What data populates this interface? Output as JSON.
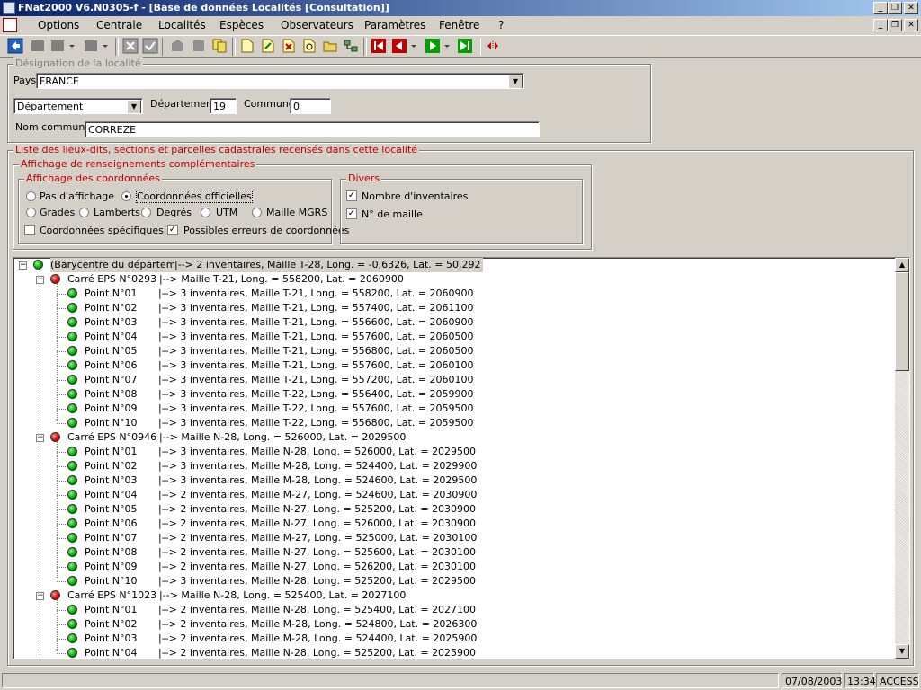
{
  "window": {
    "title": "FNat2000 V6.N0305-f - [Base de données Localités [Consultation]]"
  },
  "menu": [
    {
      "label": "Options"
    },
    {
      "label": "Centrale"
    },
    {
      "label": "Localités"
    },
    {
      "label": "Espèces"
    },
    {
      "label": "Observateurs"
    },
    {
      "label": "Paramètres"
    },
    {
      "label": "Fenêtre"
    },
    {
      "label": "?"
    }
  ],
  "designation": {
    "group_label": "Désignation de la localité",
    "pays_label": "Pays",
    "pays_value": "FRANCE",
    "type_value": "Département",
    "departement_label": "Département",
    "departement_value": "19",
    "commune_label": "Commune",
    "commune_value": "0",
    "nom_commune_label": "Nom commune",
    "nom_commune_value": "CORREZE"
  },
  "liste": {
    "group_label": "Liste des lieux-dits, sections et parcelles cadastrales recensés dans cette localité",
    "affichage_label": "Affichage de renseignements complémentaires",
    "coord_label": "Affichage des coordonnées",
    "opt_pas": "Pas d'affichage",
    "opt_officielles": "Coordonnées officielles",
    "opt_grades": "Grades",
    "opt_lamberts": "Lamberts",
    "opt_degres": "Degrés",
    "opt_utm": "UTM",
    "opt_maille": "Maille MGRS",
    "chk_specifiques": "Coordonnées spécifiques",
    "chk_erreurs": "Possibles erreurs de coordonnées",
    "divers_label": "Divers",
    "chk_nombre": "Nombre d'inventaires",
    "chk_maille": "N° de maille"
  },
  "tree": {
    "root": {
      "label": "(Barycentre du département)",
      "info": "|--> 2 inventaires, Maille T-28, Long. = -0,6326, Lat. = 50,292"
    },
    "groups": [
      {
        "label": "Carré EPS N°0293",
        "info": "|--> Maille T-21, Long. = 558200, Lat. = 2060900",
        "points": [
          {
            "label": "Point N°01",
            "info": "|--> 3 inventaires, Maille T-21, Long. = 558200, Lat. = 2060900"
          },
          {
            "label": "Point N°02",
            "info": "|--> 3 inventaires, Maille T-21, Long. = 557400, Lat. = 2061100"
          },
          {
            "label": "Point N°03",
            "info": "|--> 3 inventaires, Maille T-21, Long. = 556600, Lat. = 2060900"
          },
          {
            "label": "Point N°04",
            "info": "|--> 3 inventaires, Maille T-21, Long. = 557600, Lat. = 2060500"
          },
          {
            "label": "Point N°05",
            "info": "|--> 3 inventaires, Maille T-21, Long. = 556800, Lat. = 2060500"
          },
          {
            "label": "Point N°06",
            "info": "|--> 3 inventaires, Maille T-21, Long. = 557600, Lat. = 2060100"
          },
          {
            "label": "Point N°07",
            "info": "|--> 3 inventaires, Maille T-21, Long. = 557200, Lat. = 2060100"
          },
          {
            "label": "Point N°08",
            "info": "|--> 3 inventaires, Maille T-22, Long. = 556400, Lat. = 2059900"
          },
          {
            "label": "Point N°09",
            "info": "|--> 3 inventaires, Maille T-22, Long. = 557600, Lat. = 2059500"
          },
          {
            "label": "Point N°10",
            "info": "|--> 3 inventaires, Maille T-22, Long. = 556800, Lat. = 2059500"
          }
        ]
      },
      {
        "label": "Carré EPS N°0946",
        "info": "|--> Maille N-28, Long. = 526000, Lat. = 2029500",
        "points": [
          {
            "label": "Point N°01",
            "info": "|--> 3 inventaires, Maille N-28, Long. = 526000, Lat. = 2029500"
          },
          {
            "label": "Point N°02",
            "info": "|--> 3 inventaires, Maille M-28, Long. = 524400, Lat. = 2029900"
          },
          {
            "label": "Point N°03",
            "info": "|--> 3 inventaires, Maille M-28, Long. = 524600, Lat. = 2029500"
          },
          {
            "label": "Point N°04",
            "info": "|--> 2 inventaires, Maille M-27, Long. = 524600, Lat. = 2030900"
          },
          {
            "label": "Point N°05",
            "info": "|--> 2 inventaires, Maille N-27, Long. = 525200, Lat. = 2030900"
          },
          {
            "label": "Point N°06",
            "info": "|--> 2 inventaires, Maille N-27, Long. = 526000, Lat. = 2030900"
          },
          {
            "label": "Point N°07",
            "info": "|--> 2 inventaires, Maille M-27, Long. = 525000, Lat. = 2030100"
          },
          {
            "label": "Point N°08",
            "info": "|--> 2 inventaires, Maille N-27, Long. = 525600, Lat. = 2030100"
          },
          {
            "label": "Point N°09",
            "info": "|--> 2 inventaires, Maille N-27, Long. = 526200, Lat. = 2030100"
          },
          {
            "label": "Point N°10",
            "info": "|--> 3 inventaires, Maille N-28, Long. = 525200, Lat. = 2029500"
          }
        ]
      },
      {
        "label": "Carré EPS N°1023",
        "info": "|--> Maille N-28, Long. = 525400, Lat. = 2027100",
        "points": [
          {
            "label": "Point N°01",
            "info": "|--> 2 inventaires, Maille N-28, Long. = 525400, Lat. = 2027100"
          },
          {
            "label": "Point N°02",
            "info": "|--> 2 inventaires, Maille M-28, Long. = 524800, Lat. = 2026300"
          },
          {
            "label": "Point N°03",
            "info": "|--> 2 inventaires, Maille M-28, Long. = 524400, Lat. = 2025900"
          },
          {
            "label": "Point N°04",
            "info": "|--> 2 inventaires, Maille N-28, Long. = 525200, Lat. = 2025900"
          }
        ]
      }
    ]
  },
  "status": {
    "date": "07/08/2003",
    "time": "13:34",
    "mode": "ACCESS"
  }
}
